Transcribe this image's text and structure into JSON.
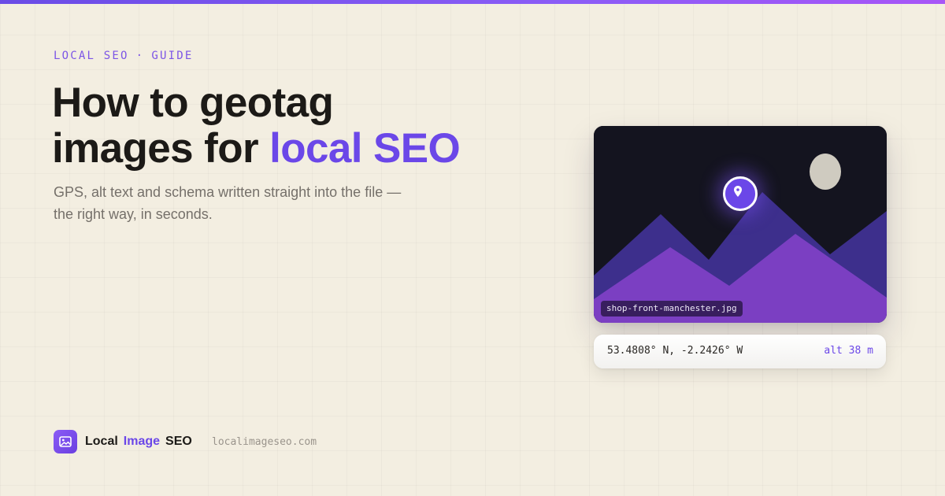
{
  "eyebrow": {
    "left": "LOCAL SEO",
    "separator": "·",
    "right": "GUIDE"
  },
  "headline": {
    "line1": "How to geotag",
    "line2_plain": "images for ",
    "line2_accent": "local SEO"
  },
  "subtitle": "GPS, alt text and schema written straight into the file — the right way, in seconds.",
  "card": {
    "filename": "shop-front-manchester.jpg",
    "pin_icon": "map-pin-icon"
  },
  "coords": {
    "latlng": "53.4808° N, -2.2426° W",
    "altitude": "alt 38 m"
  },
  "brand": {
    "logo_icon": "image-icon",
    "word1": "Local",
    "word2": "Image",
    "word3": "SEO",
    "domain": "localimageseo.com"
  },
  "colors": {
    "accent": "#6b47e8",
    "background": "#f3eee1",
    "text": "#1c1a17",
    "muted": "#75706a"
  }
}
